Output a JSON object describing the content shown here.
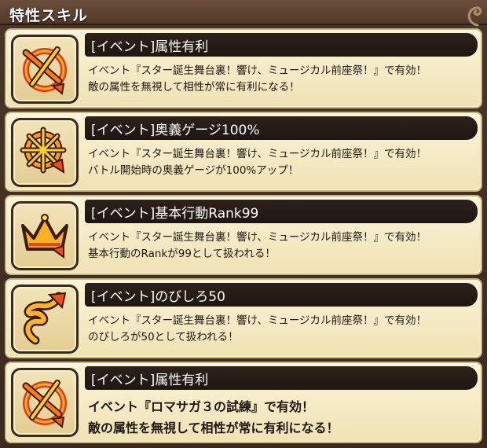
{
  "header": {
    "title": "特性スキル"
  },
  "skills": [
    {
      "icon": "target-arrow-icon",
      "title": "[イベント]属性有利",
      "lines": [
        "イベント『スター誕生舞台裏！響け、ミュージカル前座祭！』で有効！",
        "敵の属性を無視して相性が常に有利になる！"
      ]
    },
    {
      "icon": "gauge-star-arrow-icon",
      "title": "[イベント]奥義ゲージ100%",
      "lines": [
        "イベント『スター誕生舞台裏！響け、ミュージカル前座祭！』で有効！",
        "バトル開始時の奥義ゲージが100%アップ！"
      ]
    },
    {
      "icon": "crown-arrow-icon",
      "title": "[イベント]基本行動Rank99",
      "lines": [
        "イベント『スター誕生舞台裏！響け、ミュージカル前座祭！』で有効！",
        "基本行動のRankが99として扱われる！"
      ]
    },
    {
      "icon": "spiral-arrow-icon",
      "title": "[イベント]のびしろ50",
      "lines": [
        "イベント『スター誕生舞台裏！響け、ミュージカル前座祭！』で有効！",
        "のびしろが50として扱われる！"
      ]
    },
    {
      "icon": "target-arrow-icon",
      "title": "[イベント]属性有利",
      "lines": [
        "イベント『ロマサガ３の試練』で有効！",
        "敵の属性を無視して相性が常に有利になる！"
      ]
    }
  ]
}
